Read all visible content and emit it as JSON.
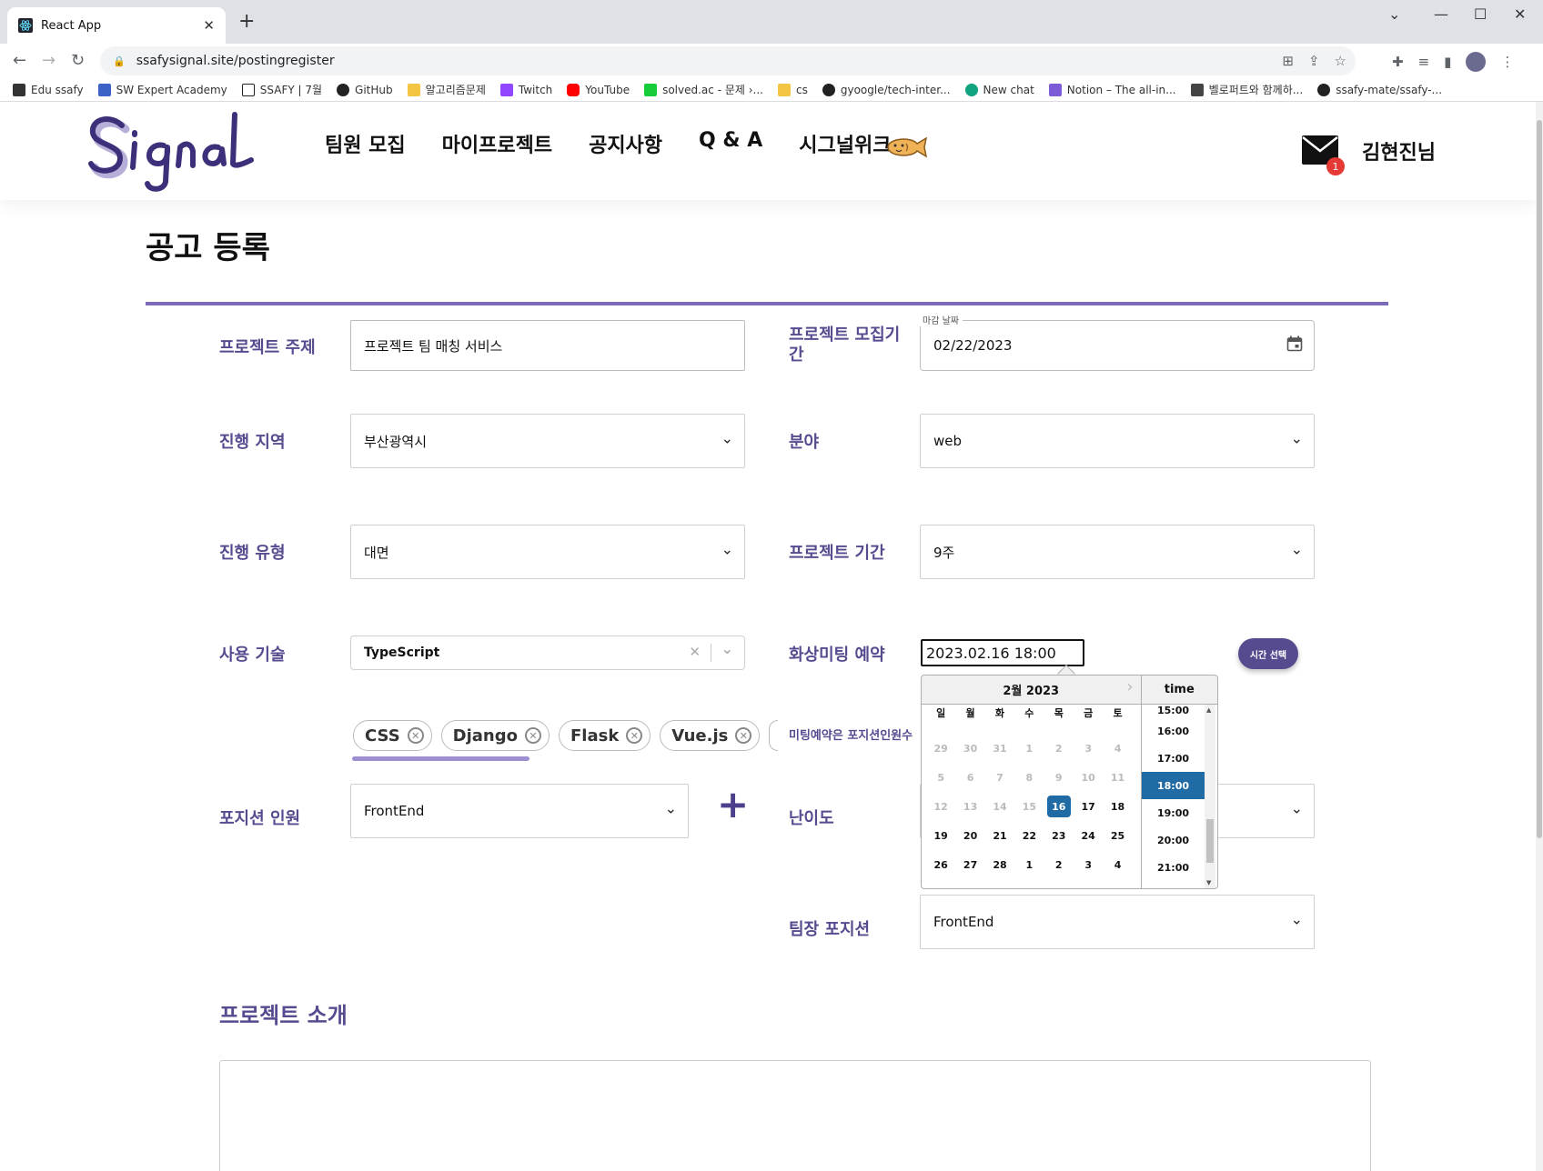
{
  "browser": {
    "tab_title": "React App",
    "url": "ssafysignal.site/postingregister",
    "bookmarks": [
      {
        "label": "Edu ssafy",
        "color": "#333333"
      },
      {
        "label": "SW Expert Academy",
        "color": "#3c62c8"
      },
      {
        "label": "SSAFY | 7월",
        "color": "#222222"
      },
      {
        "label": "GitHub",
        "color": "#222222"
      },
      {
        "label": "알고리즘문제",
        "color": "#f4c542"
      },
      {
        "label": "Twitch",
        "color": "#9146ff"
      },
      {
        "label": "YouTube",
        "color": "#ff0000"
      },
      {
        "label": "solved.ac - 문제 ›...",
        "color": "#17ce3a"
      },
      {
        "label": "cs",
        "color": "#f4c542"
      },
      {
        "label": "gyoogle/tech-inter...",
        "color": "#222222"
      },
      {
        "label": "New chat",
        "color": "#10a37f"
      },
      {
        "label": "Notion – The all-in...",
        "color": "#7b5bd6"
      },
      {
        "label": "벨로퍼트와 함께하...",
        "color": "#444444"
      },
      {
        "label": "ssafy-mate/ssafy-...",
        "color": "#222222"
      }
    ]
  },
  "header": {
    "logo_text": "Signal",
    "nav": [
      "팀원 모집",
      "마이프로젝트",
      "공지사항",
      "Q & A",
      "시그널위크"
    ],
    "mail_count": "1",
    "username": "김현진님"
  },
  "page": {
    "title": "공고 등록"
  },
  "form": {
    "subject_label": "프로젝트 주제",
    "subject_value": "프로젝트 팀 매칭 서비스",
    "recruit_period_label": "프로젝트 모집기간",
    "deadline_label": "마감 날짜",
    "deadline_value": "02/22/2023",
    "region_label": "진행 지역",
    "region_value": "부산광역시",
    "field_label": "분야",
    "field_value": "web",
    "type_label": "진행 유형",
    "type_value": "대면",
    "duration_label": "프로젝트 기간",
    "duration_value": "9주",
    "tech_label": "사용 기술",
    "tech_value": "TypeScript",
    "tech_chips": [
      "CSS",
      "Django",
      "Flask",
      "Vue.js"
    ],
    "meeting_label": "화상미팅 예약",
    "meeting_value": "2023.02.16  18:00",
    "time_button": "시간 선택",
    "meeting_note": "미팅예약은 포지션인원수",
    "position_label": "포지션 인원",
    "position_value": "FrontEnd",
    "difficulty_label": "난이도",
    "leader_label": "팀장 포지션",
    "leader_value": "FrontEnd",
    "intro_label": "프로젝트 소개"
  },
  "datepicker": {
    "month_label": "2월 2023",
    "day_names": [
      "일",
      "월",
      "화",
      "수",
      "목",
      "금",
      "토"
    ],
    "weeks": [
      [
        "29",
        "30",
        "31",
        "1",
        "2",
        "3",
        "4"
      ],
      [
        "5",
        "6",
        "7",
        "8",
        "9",
        "10",
        "11"
      ],
      [
        "12",
        "13",
        "14",
        "15",
        "16",
        "17",
        "18"
      ],
      [
        "19",
        "20",
        "21",
        "22",
        "23",
        "24",
        "25"
      ],
      [
        "26",
        "27",
        "28",
        "1",
        "2",
        "3",
        "4"
      ]
    ],
    "selected_day": "16",
    "time_header": "time",
    "times": [
      "15:00",
      "16:00",
      "17:00",
      "18:00",
      "19:00",
      "20:00",
      "21:00"
    ],
    "selected_time": "18:00"
  },
  "colors": {
    "brand": "#574b90",
    "selected": "#216ba5",
    "badge": "#e53935"
  }
}
